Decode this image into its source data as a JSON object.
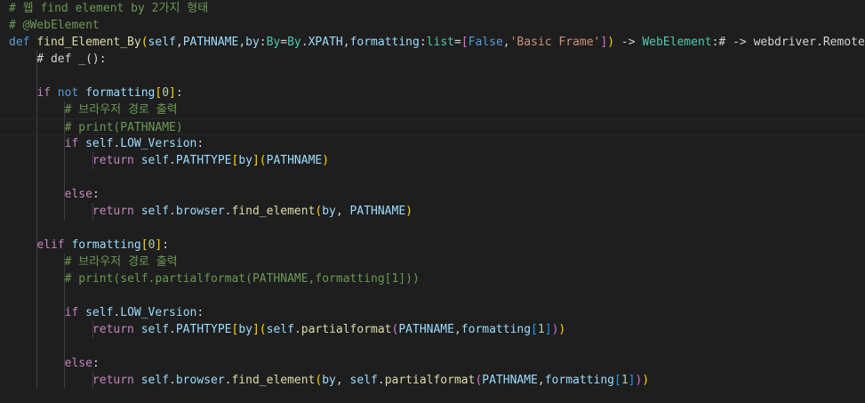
{
  "editor": {
    "language": "python",
    "theme_colors": {
      "background": "#1e1e1e",
      "comment": "#6a9955",
      "keyword": "#569cd6",
      "control": "#c586c0",
      "function": "#dcdcaa",
      "class": "#4ec9b0",
      "variable": "#9cdcfe",
      "string": "#ce9178",
      "number": "#b5cea8",
      "bracket_gold": "#ffd700",
      "bracket_purple": "#da70d6",
      "bracket_blue": "#179fff"
    },
    "lines": [
      {
        "tokens": [
          {
            "t": "# 웹 find element by 2가지 형태",
            "c": "comment"
          }
        ]
      },
      {
        "tokens": [
          {
            "t": "# @WebElement",
            "c": "comment"
          }
        ]
      },
      {
        "tokens": [
          {
            "t": "def",
            "c": "keyword"
          },
          {
            "t": " ",
            "c": "plain"
          },
          {
            "t": "find_Element_By",
            "c": "function"
          },
          {
            "t": "(",
            "c": "b-gold"
          },
          {
            "t": "self",
            "c": "var"
          },
          {
            "t": ",",
            "c": "plain"
          },
          {
            "t": "PATHNAME",
            "c": "var"
          },
          {
            "t": ",",
            "c": "plain"
          },
          {
            "t": "by",
            "c": "var"
          },
          {
            "t": ":",
            "c": "plain"
          },
          {
            "t": "By",
            "c": "class"
          },
          {
            "t": "=",
            "c": "plain"
          },
          {
            "t": "By",
            "c": "class"
          },
          {
            "t": ".",
            "c": "plain"
          },
          {
            "t": "XPATH",
            "c": "var"
          },
          {
            "t": ",",
            "c": "plain"
          },
          {
            "t": "formatting",
            "c": "var"
          },
          {
            "t": ":",
            "c": "plain"
          },
          {
            "t": "list",
            "c": "class"
          },
          {
            "t": "=",
            "c": "plain"
          },
          {
            "t": "[",
            "c": "b-purple"
          },
          {
            "t": "False",
            "c": "keyword"
          },
          {
            "t": ",",
            "c": "plain"
          },
          {
            "t": "'Basic Frame'",
            "c": "string"
          },
          {
            "t": "]",
            "c": "b-purple"
          },
          {
            "t": ")",
            "c": "b-gold"
          },
          {
            "t": " -> ",
            "c": "plain"
          },
          {
            "t": "WebElement",
            "c": "class"
          },
          {
            "t": ":# -> webdriver.Remote:",
            "c": "plain"
          }
        ]
      },
      {
        "tokens": [
          {
            "t": "    # def _():",
            "c": "plain"
          }
        ]
      },
      {
        "tokens": []
      },
      {
        "tokens": [
          {
            "t": "    ",
            "c": "plain"
          },
          {
            "t": "if",
            "c": "control"
          },
          {
            "t": " ",
            "c": "plain"
          },
          {
            "t": "not",
            "c": "keyword"
          },
          {
            "t": " ",
            "c": "plain"
          },
          {
            "t": "formatting",
            "c": "var"
          },
          {
            "t": "[",
            "c": "b-gold"
          },
          {
            "t": "0",
            "c": "number"
          },
          {
            "t": "]",
            "c": "b-gold"
          },
          {
            "t": ":",
            "c": "plain"
          }
        ]
      },
      {
        "tokens": [
          {
            "t": "        ",
            "c": "plain"
          },
          {
            "t": "# 브라우저 경로 출력",
            "c": "comment"
          }
        ]
      },
      {
        "current": true,
        "tokens": [
          {
            "t": "        ",
            "c": "plain"
          },
          {
            "t": "# print(PATHNAME)",
            "c": "comment"
          }
        ]
      },
      {
        "tokens": [
          {
            "t": "        ",
            "c": "plain"
          },
          {
            "t": "if",
            "c": "control"
          },
          {
            "t": " ",
            "c": "plain"
          },
          {
            "t": "self",
            "c": "var"
          },
          {
            "t": ".",
            "c": "plain"
          },
          {
            "t": "LOW_Version",
            "c": "var"
          },
          {
            "t": ":",
            "c": "plain"
          }
        ]
      },
      {
        "tokens": [
          {
            "t": "            ",
            "c": "plain"
          },
          {
            "t": "return",
            "c": "control"
          },
          {
            "t": " ",
            "c": "plain"
          },
          {
            "t": "self",
            "c": "var"
          },
          {
            "t": ".",
            "c": "plain"
          },
          {
            "t": "PATHTYPE",
            "c": "var"
          },
          {
            "t": "[",
            "c": "b-gold"
          },
          {
            "t": "by",
            "c": "var"
          },
          {
            "t": "]",
            "c": "b-gold"
          },
          {
            "t": "(",
            "c": "b-gold"
          },
          {
            "t": "PATHNAME",
            "c": "var"
          },
          {
            "t": ")",
            "c": "b-gold"
          }
        ]
      },
      {
        "tokens": []
      },
      {
        "tokens": [
          {
            "t": "        ",
            "c": "plain"
          },
          {
            "t": "else",
            "c": "control"
          },
          {
            "t": ":",
            "c": "plain"
          }
        ]
      },
      {
        "tokens": [
          {
            "t": "            ",
            "c": "plain"
          },
          {
            "t": "return",
            "c": "control"
          },
          {
            "t": " ",
            "c": "plain"
          },
          {
            "t": "self",
            "c": "var"
          },
          {
            "t": ".",
            "c": "plain"
          },
          {
            "t": "browser",
            "c": "var"
          },
          {
            "t": ".",
            "c": "plain"
          },
          {
            "t": "find_element",
            "c": "function"
          },
          {
            "t": "(",
            "c": "b-gold"
          },
          {
            "t": "by",
            "c": "var"
          },
          {
            "t": ", ",
            "c": "plain"
          },
          {
            "t": "PATHNAME",
            "c": "var"
          },
          {
            "t": ")",
            "c": "b-gold"
          }
        ]
      },
      {
        "tokens": []
      },
      {
        "tokens": [
          {
            "t": "    ",
            "c": "plain"
          },
          {
            "t": "elif",
            "c": "control"
          },
          {
            "t": " ",
            "c": "plain"
          },
          {
            "t": "formatting",
            "c": "var"
          },
          {
            "t": "[",
            "c": "b-gold"
          },
          {
            "t": "0",
            "c": "number"
          },
          {
            "t": "]",
            "c": "b-gold"
          },
          {
            "t": ":",
            "c": "plain"
          }
        ]
      },
      {
        "tokens": [
          {
            "t": "        ",
            "c": "plain"
          },
          {
            "t": "# 브라우저 경로 출력",
            "c": "comment"
          }
        ]
      },
      {
        "tokens": [
          {
            "t": "        ",
            "c": "plain"
          },
          {
            "t": "# print(self.partialformat(PATHNAME,formatting[1]))",
            "c": "comment"
          }
        ]
      },
      {
        "tokens": []
      },
      {
        "tokens": [
          {
            "t": "        ",
            "c": "plain"
          },
          {
            "t": "if",
            "c": "control"
          },
          {
            "t": " ",
            "c": "plain"
          },
          {
            "t": "self",
            "c": "var"
          },
          {
            "t": ".",
            "c": "plain"
          },
          {
            "t": "LOW_Version",
            "c": "var"
          },
          {
            "t": ":",
            "c": "plain"
          }
        ]
      },
      {
        "tokens": [
          {
            "t": "            ",
            "c": "plain"
          },
          {
            "t": "return",
            "c": "control"
          },
          {
            "t": " ",
            "c": "plain"
          },
          {
            "t": "self",
            "c": "var"
          },
          {
            "t": ".",
            "c": "plain"
          },
          {
            "t": "PATHTYPE",
            "c": "var"
          },
          {
            "t": "[",
            "c": "b-gold"
          },
          {
            "t": "by",
            "c": "var"
          },
          {
            "t": "]",
            "c": "b-gold"
          },
          {
            "t": "(",
            "c": "b-gold"
          },
          {
            "t": "self",
            "c": "var"
          },
          {
            "t": ".",
            "c": "plain"
          },
          {
            "t": "partialformat",
            "c": "function"
          },
          {
            "t": "(",
            "c": "b-purple"
          },
          {
            "t": "PATHNAME",
            "c": "var"
          },
          {
            "t": ",",
            "c": "plain"
          },
          {
            "t": "formatting",
            "c": "var"
          },
          {
            "t": "[",
            "c": "b-blue"
          },
          {
            "t": "1",
            "c": "number"
          },
          {
            "t": "]",
            "c": "b-blue"
          },
          {
            "t": ")",
            "c": "b-purple"
          },
          {
            "t": ")",
            "c": "b-gold"
          }
        ]
      },
      {
        "tokens": []
      },
      {
        "tokens": [
          {
            "t": "        ",
            "c": "plain"
          },
          {
            "t": "else",
            "c": "control"
          },
          {
            "t": ":",
            "c": "plain"
          }
        ]
      },
      {
        "tokens": [
          {
            "t": "            ",
            "c": "plain"
          },
          {
            "t": "return",
            "c": "control"
          },
          {
            "t": " ",
            "c": "plain"
          },
          {
            "t": "self",
            "c": "var"
          },
          {
            "t": ".",
            "c": "plain"
          },
          {
            "t": "browser",
            "c": "var"
          },
          {
            "t": ".",
            "c": "plain"
          },
          {
            "t": "find_element",
            "c": "function"
          },
          {
            "t": "(",
            "c": "b-gold"
          },
          {
            "t": "by",
            "c": "var"
          },
          {
            "t": ", ",
            "c": "plain"
          },
          {
            "t": "self",
            "c": "var"
          },
          {
            "t": ".",
            "c": "plain"
          },
          {
            "t": "partialformat",
            "c": "function"
          },
          {
            "t": "(",
            "c": "b-purple"
          },
          {
            "t": "PATHNAME",
            "c": "var"
          },
          {
            "t": ",",
            "c": "plain"
          },
          {
            "t": "formatting",
            "c": "var"
          },
          {
            "t": "[",
            "c": "b-blue"
          },
          {
            "t": "1",
            "c": "number"
          },
          {
            "t": "]",
            "c": "b-blue"
          },
          {
            "t": ")",
            "c": "b-purple"
          },
          {
            "t": ")",
            "c": "b-gold"
          }
        ]
      }
    ]
  }
}
